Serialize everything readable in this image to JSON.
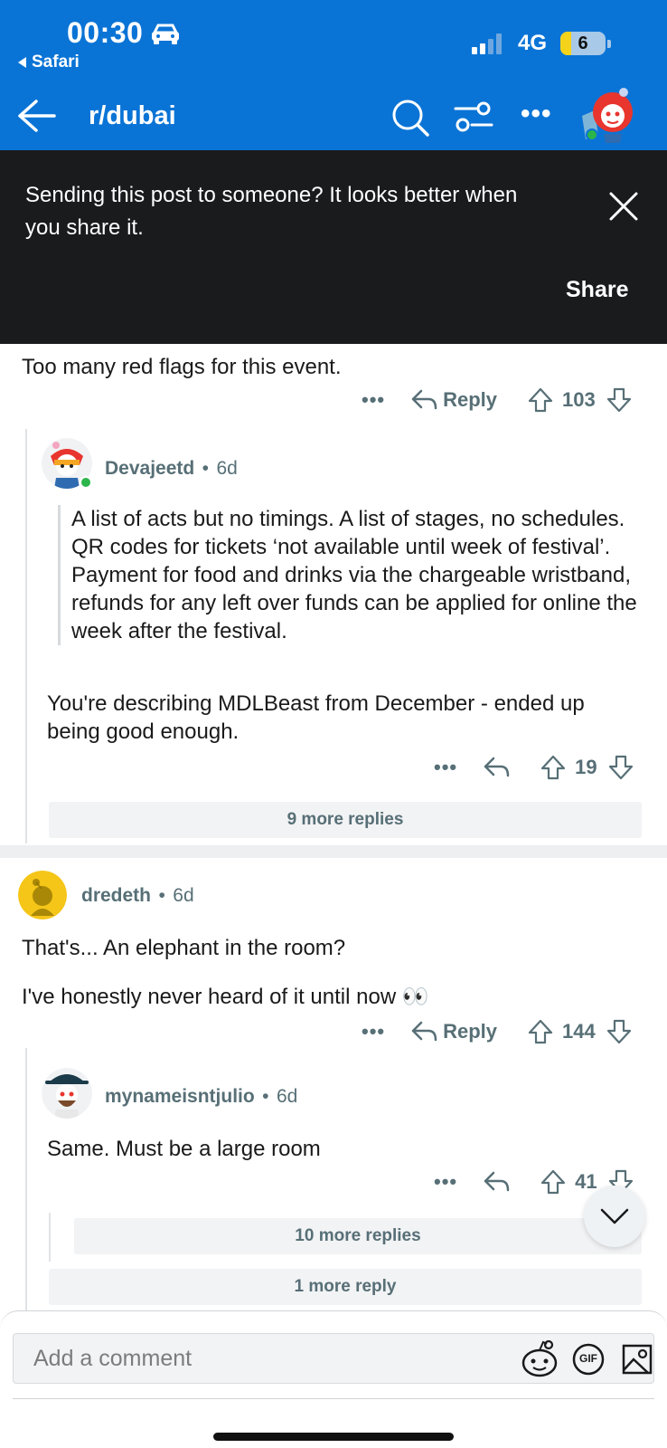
{
  "status_bar": {
    "time": "00:30",
    "back_app": "Safari",
    "network": "4G",
    "battery": "6",
    "icons": [
      "car-icon",
      "signal-icon",
      "battery-icon"
    ]
  },
  "header": {
    "subreddit": "r/dubai",
    "icons": [
      "back-arrow-icon",
      "search-icon",
      "filter-icon",
      "more-icon",
      "avatar"
    ]
  },
  "share_banner": {
    "text": "Sending this post to someone? It looks better when you share it.",
    "share_label": "Share"
  },
  "comments": [
    {
      "text": "Too many red flags for this event.",
      "actions": {
        "more": "•••",
        "reply": "Reply",
        "votes": "103"
      }
    },
    {
      "user": "Devajeetd",
      "separator": "•",
      "age": "6d",
      "quote": "A list of acts but no timings. A list of stages, no schedules. QR codes for tickets ‘not available until week of festival’. Payment for food and drinks via the chargeable wristband, refunds for any left over funds can be applied for online the week after the festival.",
      "text": "You're describing MDLBeast from December - ended up being good enough.",
      "actions": {
        "more": "•••",
        "votes": "19"
      },
      "more_replies": "9 more replies"
    },
    {
      "user": "dredeth",
      "separator": "•",
      "age": "6d",
      "text1": "That's... An elephant in the room?",
      "text2": "I've honestly never heard of it until now 👀",
      "actions": {
        "more": "•••",
        "reply": "Reply",
        "votes": "144"
      }
    },
    {
      "user": "mynameisntjulio",
      "separator": "•",
      "age": "6d",
      "text": "Same. Must be a large room",
      "actions": {
        "more": "•••",
        "votes": "41"
      },
      "more_replies": "10 more replies"
    }
  ],
  "thread_more": "1 more reply",
  "comment_bar": {
    "placeholder": "Add a comment",
    "gif_label": "GIF"
  },
  "colors": {
    "brand_blue": "#0a74d6",
    "banner_bg": "#1a1b1d",
    "meta_gray": "#576f76"
  }
}
